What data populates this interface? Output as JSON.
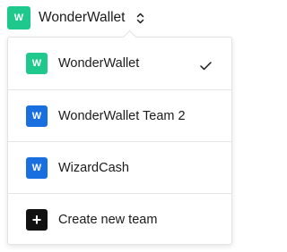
{
  "current_team": {
    "initial": "W",
    "name": "WonderWallet",
    "color": "#1fc98d",
    "toggle_icon": "chevron-up-down-icon"
  },
  "teams": [
    {
      "initial": "W",
      "name": "WonderWallet",
      "color": "#1fc98d",
      "selected": true
    },
    {
      "initial": "W",
      "name": "WonderWallet Team 2",
      "color": "#1a6fe0",
      "selected": false
    },
    {
      "initial": "W",
      "name": "WizardCash",
      "color": "#1a6fe0",
      "selected": false
    }
  ],
  "create_team": {
    "icon": "+",
    "label": "Create new team",
    "color": "#111111"
  },
  "selected_icon": "checkmark-icon"
}
